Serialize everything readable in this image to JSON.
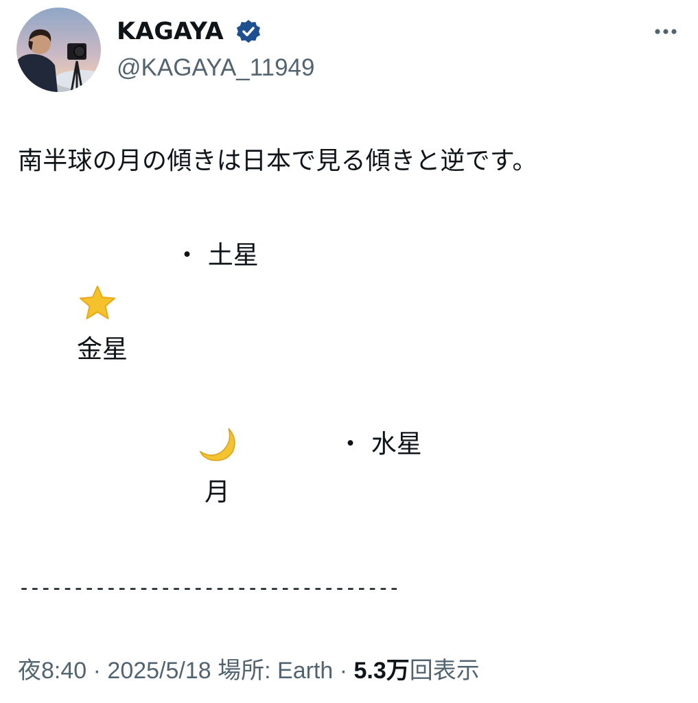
{
  "author": {
    "display_name": "KAGAYA",
    "handle": "@KAGAYA_11949",
    "verified": true,
    "verified_color": "#1d4f91",
    "avatar_icon": "profile-photo-man-with-camera-icon"
  },
  "more_icon": "more-dots-icon",
  "tweet": {
    "line1": "南半球の月の傾きは日本で見る傾きと逆です。",
    "saturn": "・ 土星",
    "venus_icon": "star-icon",
    "venus": "金星",
    "moon_icon": "crescent-moon-icon",
    "mercury": "・ 水星",
    "moon": "月",
    "dashes": "-----------------------------------"
  },
  "meta": {
    "time": "夜8:40",
    "sep1": " · ",
    "date": "2025/5/18",
    "location": " 場所: Earth",
    "sep2": " · ",
    "views_count": "5.3万",
    "views_label": "回表示"
  },
  "colors": {
    "text": "#0f1419",
    "secondary": "#536471",
    "star": "#f6c22b",
    "moon": "#f4c430"
  }
}
